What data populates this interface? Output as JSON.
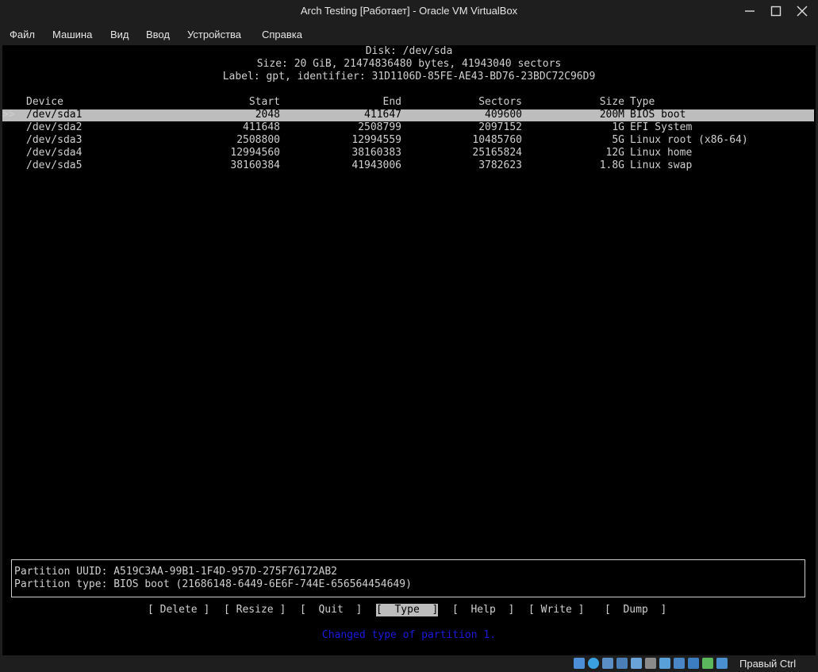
{
  "window": {
    "title": "Arch Testing [Работает] - Oracle VM VirtualBox",
    "controls": [
      "minimize-icon",
      "maximize-icon",
      "close-icon"
    ]
  },
  "menu": [
    "Файл",
    "Машина",
    "Вид",
    "Ввод",
    "Устройства",
    "Справка"
  ],
  "disk": {
    "heading": "Disk: /dev/sda",
    "size_line": "Size: 20 GiB, 21474836480 bytes, 41943040 sectors",
    "label_line": "Label: gpt, identifier: 31D1106D-85FE-AE43-BD76-23BDC72C96D9"
  },
  "table": {
    "headers": {
      "device": "Device",
      "start": "Start",
      "end": "End",
      "sectors": "Sectors",
      "size": "Size",
      "type": "Type"
    },
    "cursor": ">>",
    "selected_index": 0,
    "rows": [
      {
        "device": "/dev/sda1",
        "start": "2048",
        "end": "411647",
        "sectors": "409600",
        "size": "200M",
        "type": "BIOS boot"
      },
      {
        "device": "/dev/sda2",
        "start": "411648",
        "end": "2508799",
        "sectors": "2097152",
        "size": "1G",
        "type": "EFI System"
      },
      {
        "device": "/dev/sda3",
        "start": "2508800",
        "end": "12994559",
        "sectors": "10485760",
        "size": "5G",
        "type": "Linux root (x86-64)"
      },
      {
        "device": "/dev/sda4",
        "start": "12994560",
        "end": "38160383",
        "sectors": "25165824",
        "size": "12G",
        "type": "Linux home"
      },
      {
        "device": "/dev/sda5",
        "start": "38160384",
        "end": "41943006",
        "sectors": "3782623",
        "size": "1.8G",
        "type": "Linux swap"
      }
    ]
  },
  "details": {
    "uuid_line": "Partition UUID: A519C3AA-99B1-1F4D-957D-275F76172AB2",
    "type_line": "Partition type: BIOS boot (21686148-6449-6E6F-744E-656564454649)"
  },
  "actions": {
    "delete": "[ Delete ]",
    "resize": "[ Resize ]",
    "quit": "[  Quit  ]",
    "type": "[  Type  ]",
    "help": "[  Help  ]",
    "write": "[ Write ]",
    "dump": "[  Dump  ]",
    "selected": "type"
  },
  "status_message": "Changed type of partition 1.",
  "statusbar": {
    "icons": [
      "hard-disk-icon",
      "optical-disk-icon",
      "audio-icon",
      "network-icon",
      "usb-icon",
      "shared-folders-icon",
      "display-icon",
      "video-capture-icon",
      "cpu-icon",
      "mouse-integration-icon",
      "keyboard-icon"
    ],
    "host_key": "Правый Ctrl"
  }
}
